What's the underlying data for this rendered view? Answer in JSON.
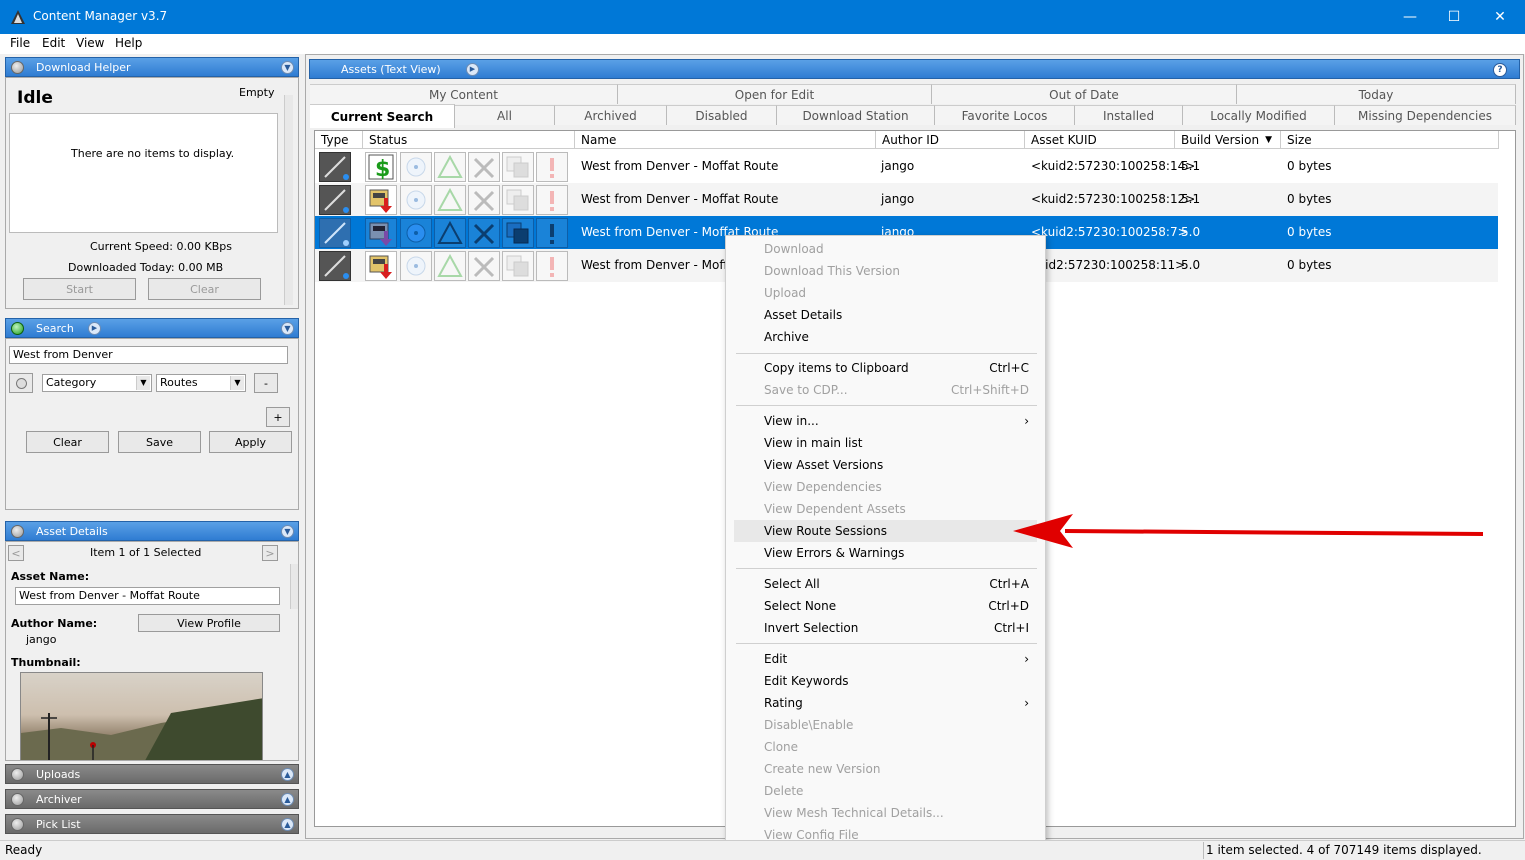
{
  "window": {
    "title": "Content Manager v3.7",
    "minimize": "—",
    "maximize": "☐",
    "close": "✕"
  },
  "menu": [
    "File",
    "Edit",
    "View",
    "Help"
  ],
  "download_helper": {
    "header": "Download Helper",
    "status": "Idle",
    "queue_state": "Empty",
    "empty_text": "There are no items to display.",
    "current_speed": "Current Speed: 0.00 KBps",
    "downloaded_today": "Downloaded Today: 0.00 MB",
    "start_label": "Start",
    "clear_label": "Clear"
  },
  "search": {
    "header": "Search",
    "query": "West from Denver",
    "field": "Category",
    "value": "Routes",
    "minus": "-",
    "plus": "+",
    "clear_label": "Clear",
    "save_label": "Save",
    "apply_label": "Apply"
  },
  "asset_details": {
    "header": "Asset Details",
    "prev": "<",
    "next": ">",
    "selection": "Item 1 of 1 Selected",
    "asset_name_label": "Asset Name:",
    "asset_name": "West from Denver - Moffat Route",
    "author_label": "Author Name:",
    "author": "jango",
    "view_profile": "View Profile",
    "thumbnail_label": "Thumbnail:"
  },
  "collapsed_panels": [
    "Uploads",
    "Archiver",
    "Pick List"
  ],
  "assets": {
    "header": "Assets (Text View)",
    "help": "?",
    "tabs_row1": [
      "My Content",
      "Open for Edit",
      "Out of Date",
      "Today"
    ],
    "tabs_row2": [
      "Current Search",
      "All",
      "Archived",
      "Disabled",
      "Download Station",
      "Favorite Locos",
      "Installed",
      "Locally Modified",
      "Missing Dependencies"
    ],
    "columns": [
      "Type",
      "Status",
      "Name",
      "Author ID",
      "Asset KUID",
      "Build Version",
      "Size"
    ],
    "rows": [
      {
        "name": "West from Denver - Moffat Route",
        "author": "jango",
        "kuid": "<kuid2:57230:100258:14>",
        "build": "5.1",
        "size": "0 bytes",
        "status": "payware-icon"
      },
      {
        "name": "West from Denver - Moffat Route",
        "author": "jango",
        "kuid": "<kuid2:57230:100258:12>",
        "build": "5.1",
        "size": "0 bytes",
        "status": "download-icon"
      },
      {
        "name": "West from Denver - Moffat Route",
        "author": "jango",
        "kuid": "<kuid2:57230:100258:7>",
        "build": "5.0",
        "size": "0 bytes",
        "status": "download-icon"
      },
      {
        "name": "West from Denver - Moffat",
        "author": "",
        "kuid": "kuid2:57230:100258:11>",
        "build": "5.0",
        "size": "0 bytes",
        "status": "download-icon"
      }
    ]
  },
  "context_menu": {
    "items": [
      {
        "label": "Download",
        "disabled": true
      },
      {
        "label": "Download This Version",
        "disabled": true
      },
      {
        "label": "Upload",
        "disabled": true
      },
      {
        "label": "Asset Details"
      },
      {
        "label": "Archive"
      },
      {
        "label": "Copy items to Clipboard",
        "shortcut": "Ctrl+C"
      },
      {
        "label": "Save to CDP...",
        "shortcut": "Ctrl+Shift+D",
        "disabled": true
      },
      {
        "label": "View in..."
      },
      {
        "label": "View in main list"
      },
      {
        "label": "View Asset Versions"
      },
      {
        "label": "View Dependencies",
        "disabled": true
      },
      {
        "label": "View Dependent Assets",
        "disabled": true
      },
      {
        "label": "View Route Sessions"
      },
      {
        "label": "View Errors & Warnings"
      },
      {
        "label": "Select All",
        "shortcut": "Ctrl+A"
      },
      {
        "label": "Select None",
        "shortcut": "Ctrl+D"
      },
      {
        "label": "Invert Selection",
        "shortcut": "Ctrl+I"
      },
      {
        "label": "Edit"
      },
      {
        "label": "Edit Keywords"
      },
      {
        "label": "Rating"
      },
      {
        "label": "Disable\\Enable",
        "disabled": true
      },
      {
        "label": "Clone",
        "disabled": true
      },
      {
        "label": "Create new Version",
        "disabled": true
      },
      {
        "label": "Delete",
        "disabled": true
      },
      {
        "label": "View Mesh Technical Details...",
        "disabled": true
      },
      {
        "label": "View Config File",
        "disabled": true
      }
    ],
    "submenu_arrow": "›"
  },
  "statusbar": {
    "left": "Ready",
    "right": "1 item selected. 4 of 707149 items displayed."
  },
  "colors": {
    "accent": "#0078d7",
    "arrow": "#e00000"
  }
}
